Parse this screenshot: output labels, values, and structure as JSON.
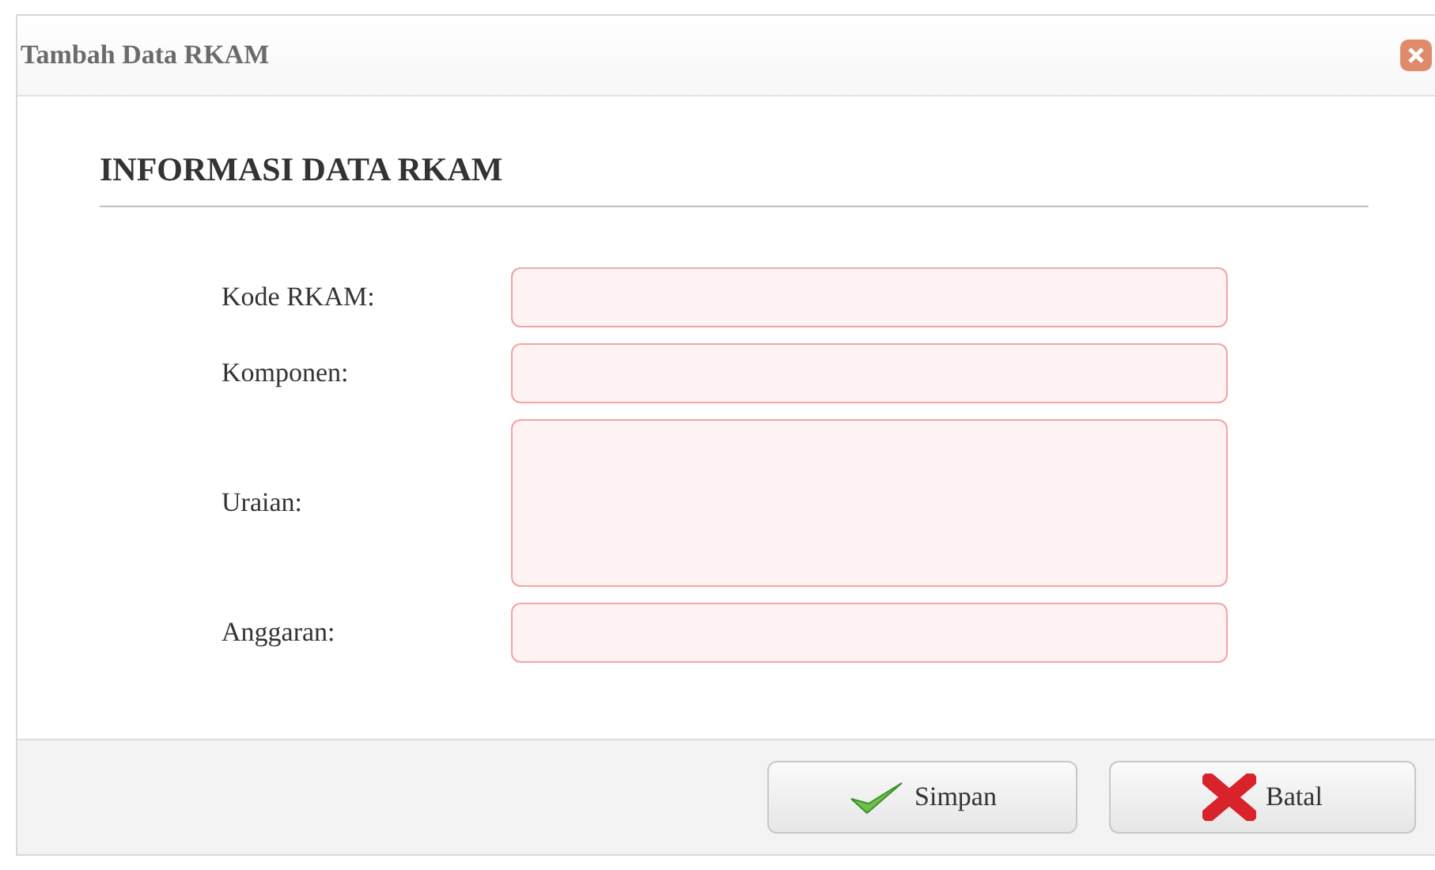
{
  "dialog": {
    "title": "Tambah Data RKAM"
  },
  "section": {
    "heading": "INFORMASI DATA RKAM"
  },
  "fields": [
    {
      "label": "Kode RKAM:",
      "kind": "text"
    },
    {
      "label": "Komponen:",
      "kind": "text"
    },
    {
      "label": "Uraian:",
      "kind": "textarea"
    },
    {
      "label": "Anggaran:",
      "kind": "text"
    }
  ],
  "buttons": [
    {
      "label": "Simpan",
      "kind": "save"
    },
    {
      "label": "Batal",
      "kind": "cancel"
    }
  ]
}
